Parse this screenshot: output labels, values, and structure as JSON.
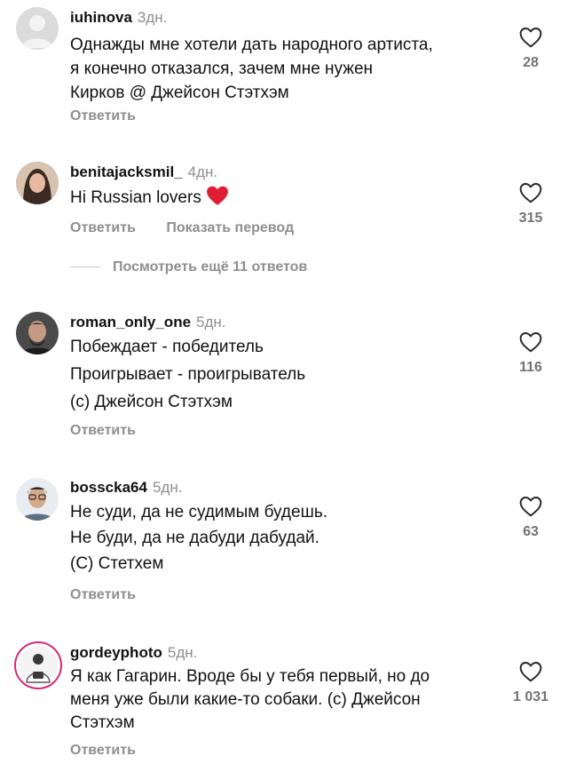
{
  "comments": [
    {
      "username": "iuhinova",
      "time": "3дн.",
      "lines": [
        "Однажды мне хотели дать народного артиста,",
        "я конечно отказался, зачем мне нужен",
        "Кирков @ Джейсон Стэтхэм"
      ],
      "reply": "Ответить",
      "likes": "28",
      "avatar": "default-avatar-icon"
    },
    {
      "username": "benitajacksmil_",
      "time": "4дн.",
      "lines": [
        "Hi Russian lovers"
      ],
      "emoji": "❤️",
      "reply": "Ответить",
      "translate": "Показать перевод",
      "likes": "315",
      "avatar": "user-photo"
    },
    {
      "username": "roman_only_one",
      "time": "5дн.",
      "lines": [
        "Побеждает - победитель",
        "Проигрывает - проигрыватель",
        "(с) Джейсон Стэтхэм"
      ],
      "reply": "Ответить",
      "likes": "116",
      "avatar": "user-photo"
    },
    {
      "username": "bosscka64",
      "time": "5дн.",
      "lines": [
        "Не суди, да не судимым будешь.",
        "Не буди, да не дабуди дабудай.",
        "(С) Стетхем"
      ],
      "reply": "Ответить",
      "likes": "63",
      "avatar": "user-photo"
    },
    {
      "username": "gordeyphoto",
      "time": "5дн.",
      "lines": [
        "Я как Гагарин. Вроде бы у тебя первый, но до",
        "меня уже были какие-то собаки. (с) Джейсон",
        "Стэтхэм"
      ],
      "reply": "Ответить",
      "likes": "1 031",
      "avatar": "user-photo"
    }
  ],
  "more_replies": "Посмотреть ещё 11 ответов",
  "colors": {
    "text": "#111111",
    "muted": "#8e8e8e",
    "heart": "#e11d35",
    "story_ring": "#d62976"
  }
}
